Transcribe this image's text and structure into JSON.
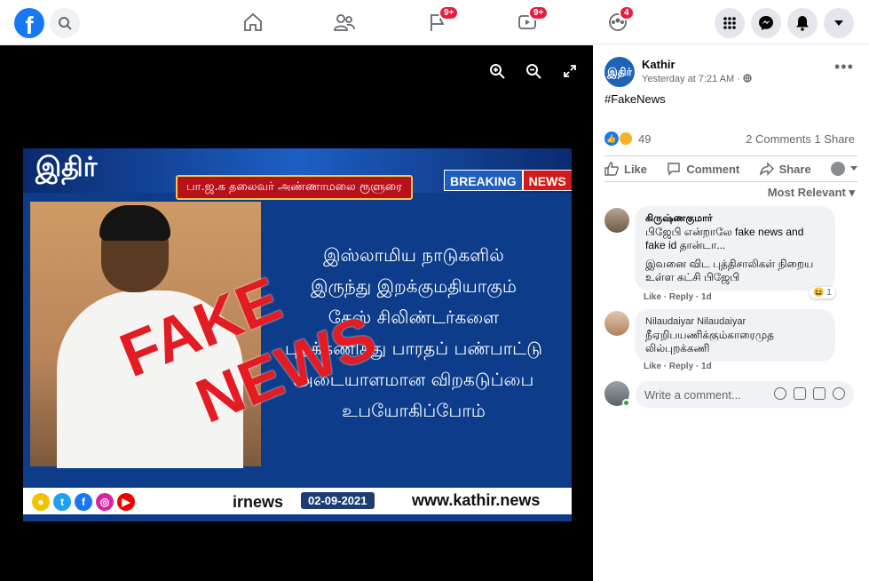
{
  "topbar": {
    "logo": "f",
    "badges": {
      "groups": "9+",
      "watch": "9+",
      "gaming": "4"
    }
  },
  "image": {
    "logo": "இதிர்",
    "headline_tag": "பா.ஜ.க தலைவர் அண்ணாமலை ரூளுரை",
    "breaking_1": "BREAKING",
    "breaking_2": "NEWS",
    "lines": [
      "இஸ்லாமிய நாடுகளில்",
      "இருந்து இறக்குமதியாகும்",
      "கேஸ் சிலிண்டர்களை",
      "புறக்கணித்து பாரதப் பண்பாட்டு",
      "அடையாளமான விறகடுப்பை",
      "உபயோகிப்போம்"
    ],
    "stamp_1": "FAKE",
    "stamp_2": "NEWS",
    "handle": "irnews",
    "date": "02-09-2021",
    "site": "www.kathir.news"
  },
  "post": {
    "page_avatar": "இதிர்",
    "page_name": "Kathir",
    "time": "Yesterday at 7:21 AM · ",
    "text": "#FakeNews",
    "reaction_count": "49",
    "comments_shares": "2 Comments  1 Share",
    "actions": {
      "like": "Like",
      "comment": "Comment",
      "share": "Share"
    },
    "sort": "Most Relevant ▾"
  },
  "comments": [
    {
      "name": "கிருஷ்ணகுமார்",
      "text1": "பிஜேபி என்றாலே fake news and fake id தான்டா...",
      "text2": "இவனை விட புத்திசாலிகள் நிறைய உள்ள கட்சி பிஜேபி",
      "meta": "Like · Reply · 1d",
      "react": "1"
    },
    {
      "name": "Nilaudaiyar Nilaudaiyar",
      "text1": "நீஏறிபயணிக்கும்காரைமுத லில்புறக்கணி",
      "meta": "Like · Reply · 1d"
    }
  ],
  "composer": {
    "placeholder": "Write a comment..."
  },
  "colors": {
    "brand": "#1877f2",
    "badge": "#e41e3f",
    "fake_red": "#e31b23"
  }
}
